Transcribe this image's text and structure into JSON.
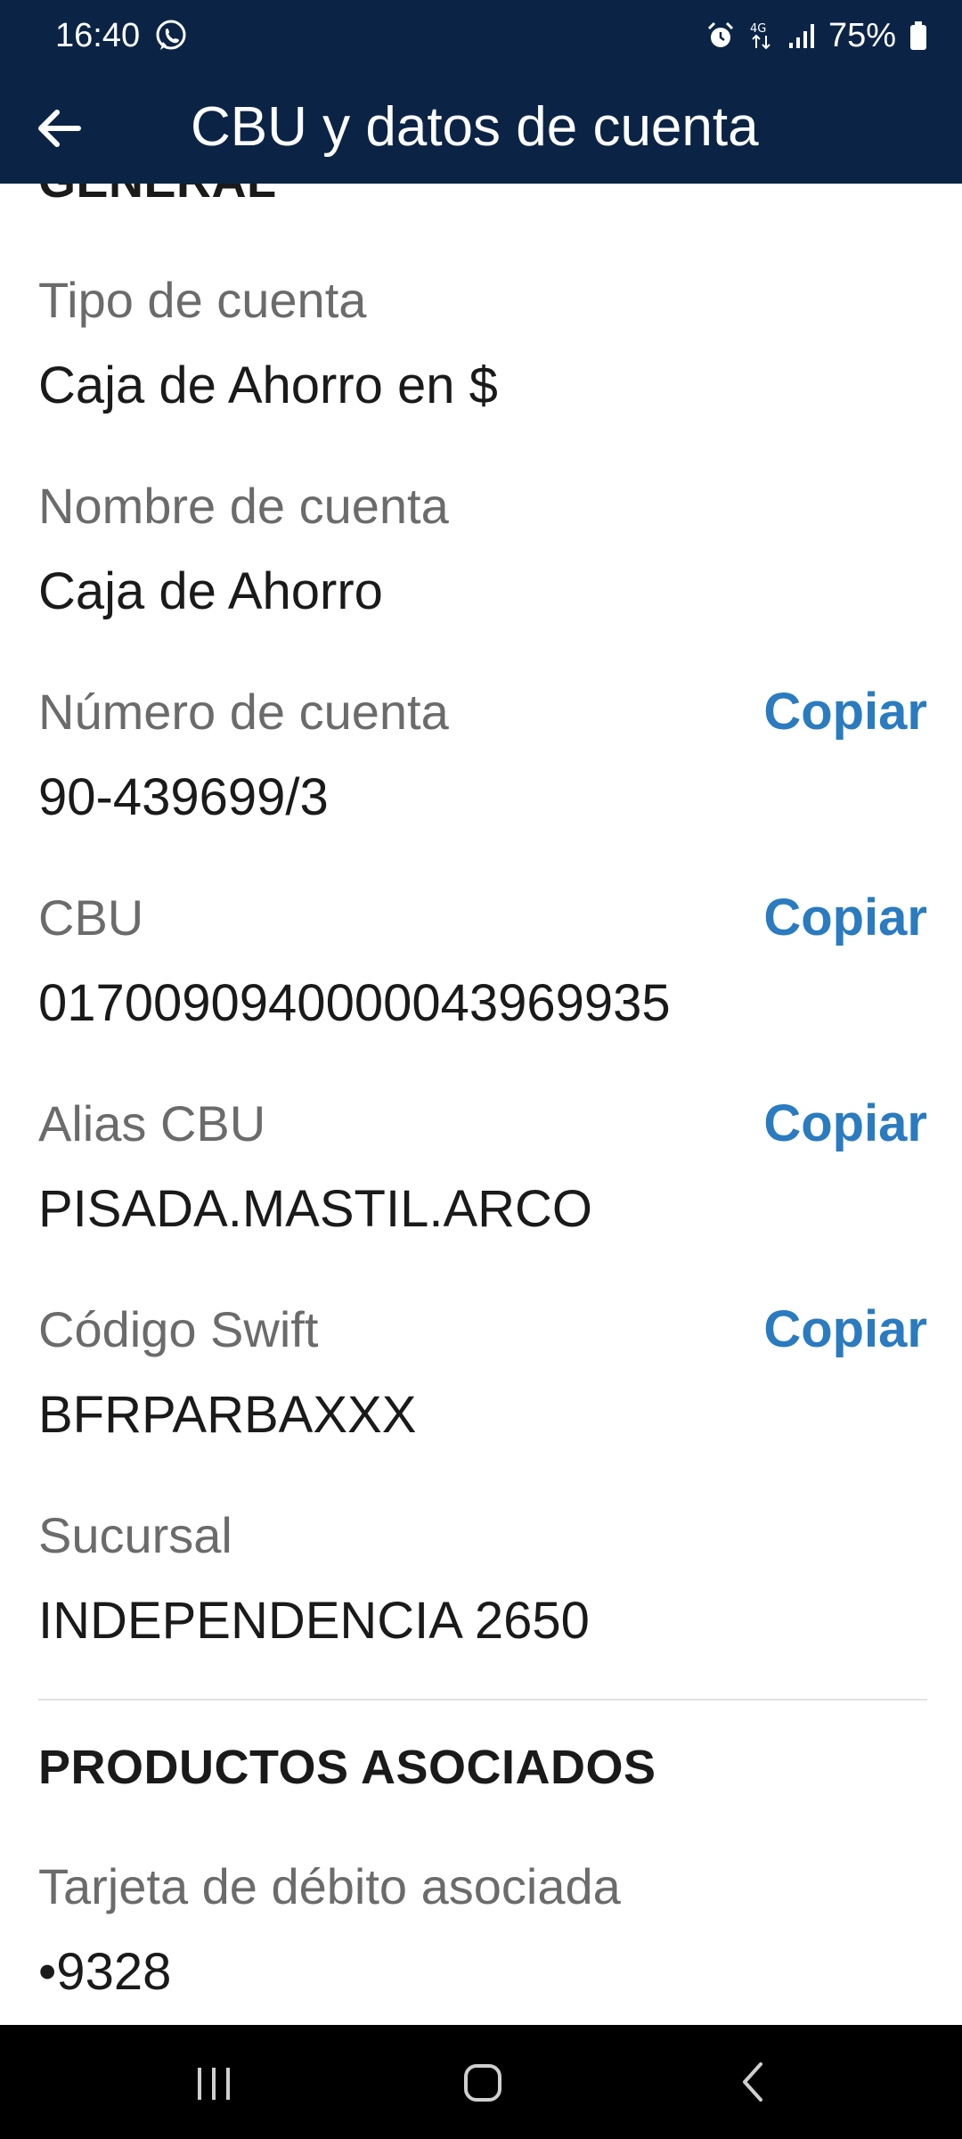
{
  "status_bar": {
    "time": "16:40",
    "battery": "75%",
    "icons": [
      "whatsapp-icon",
      "alarm-icon",
      "network-4g-icon",
      "signal-icon",
      "battery-icon"
    ]
  },
  "app_bar": {
    "title": "CBU y datos de cuenta",
    "back_icon": "arrow-left-icon"
  },
  "general": {
    "heading": "GENERAL",
    "fields": [
      {
        "label": "Tipo de cuenta",
        "value": "Caja de Ahorro en $"
      },
      {
        "label": "Nombre de cuenta",
        "value": "Caja de Ahorro"
      },
      {
        "label": "Número de cuenta",
        "value": "90-439699/3",
        "action": "Copiar"
      },
      {
        "label": "CBU",
        "value": "0170090940000043969935",
        "action": "Copiar"
      },
      {
        "label": "Alias CBU",
        "value": "PISADA.MASTIL.ARCO",
        "action": "Copiar"
      },
      {
        "label": "Código Swift",
        "value": "BFRPARBAXXX",
        "action": "Copiar"
      },
      {
        "label": "Sucursal",
        "value": "INDEPENDENCIA 2650"
      }
    ]
  },
  "productos": {
    "heading": "PRODUCTOS ASOCIADOS",
    "fields": [
      {
        "label": "Tarjeta de débito asociada",
        "value": "•9328"
      }
    ]
  },
  "nav_bar": {
    "icons": [
      "recent-apps-icon",
      "home-icon",
      "back-icon"
    ]
  },
  "colors": {
    "header_bg": "#0b2446",
    "accent": "#2a7bbf",
    "label": "#6b6b6b",
    "text": "#1a1a1a"
  }
}
